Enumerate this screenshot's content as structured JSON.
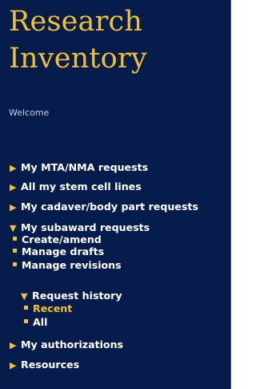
{
  "app": {
    "title_line1": "Research",
    "title_line2": "Inventory",
    "welcome": "Welcome"
  },
  "nav": {
    "mta_nma": "My MTA/NMA requests",
    "stem_cells": "All my stem cell lines",
    "cadaver": "My cadaver/body part requests",
    "subaward": "My subaward requests",
    "subaward_items": {
      "create": "Create/amend",
      "drafts": "Manage drafts",
      "revisions": "Manage revisions"
    },
    "request_history": "Request history",
    "history_items": {
      "recent": "Recent",
      "all": "All"
    },
    "authorizations": "My authorizations",
    "resources": "Resources"
  },
  "icons": {
    "collapsed": "triangle-right",
    "expanded": "triangle-down",
    "bullet": "square"
  },
  "colors": {
    "sidebar_bg": "#061c4d",
    "accent": "#f2c12e",
    "text": "#ffffff"
  }
}
